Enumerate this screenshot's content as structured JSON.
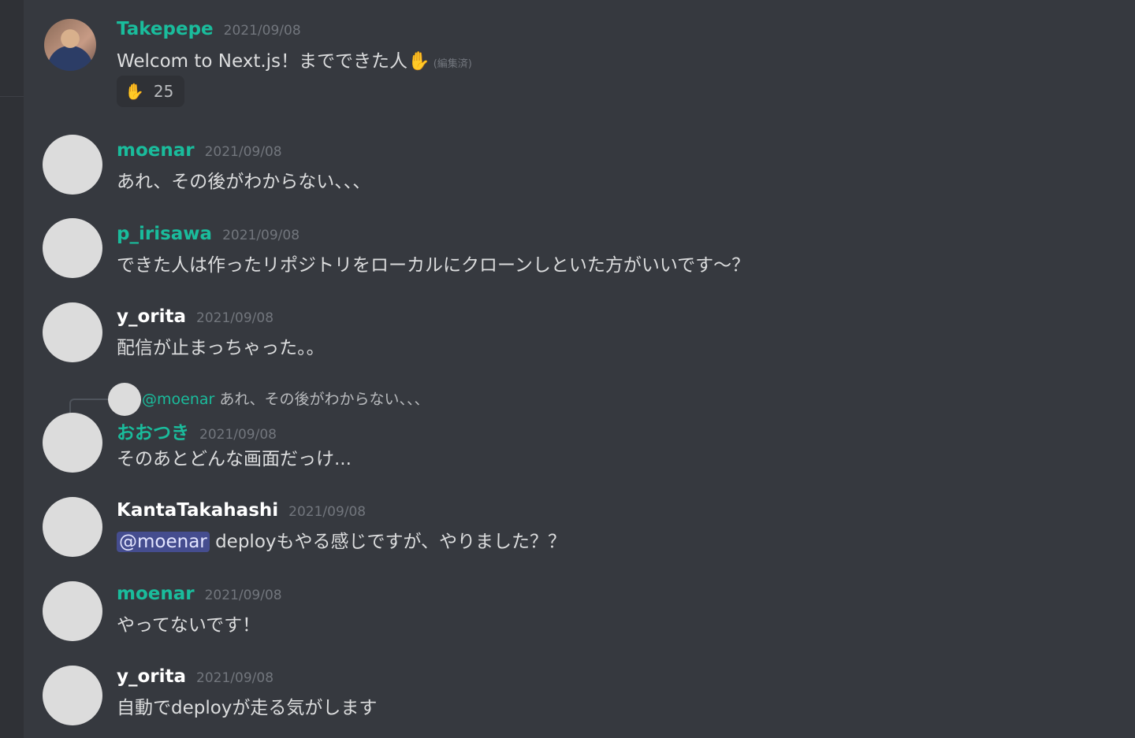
{
  "messages": [
    {
      "username": "Takepepe",
      "timestamp": "2021/09/08",
      "content": "Welcom to Next.js！までできた人",
      "hand": "✋",
      "edited": "(編集済)",
      "reaction": {
        "emoji": "✋",
        "count": "25"
      }
    },
    {
      "username": "moenar",
      "timestamp": "2021/09/08",
      "content": "あれ、その後がわからない、、、"
    },
    {
      "username": "p_irisawa",
      "timestamp": "2021/09/08",
      "content": "できた人は作ったリポジトリをローカルにクローンしといた方がいいです〜？"
    },
    {
      "username": "y_orita",
      "timestamp": "2021/09/08",
      "content": "配信が止まっちゃった。。"
    },
    {
      "reply": {
        "mention": "@moenar",
        "text": "あれ、その後がわからない、、、"
      },
      "username": "おおつき",
      "timestamp": "2021/09/08",
      "content": "そのあとどんな画面だっけ..."
    },
    {
      "username": "KantaTakahashi",
      "timestamp": "2021/09/08",
      "mention": "@moenar",
      "content": " deployもやる感じですが、やりました？？"
    },
    {
      "username": "moenar",
      "timestamp": "2021/09/08",
      "content": "やってないです！"
    },
    {
      "username": "y_orita",
      "timestamp": "2021/09/08",
      "content": "自動でdeployが走る気がします"
    }
  ],
  "colors": {
    "background": "#36393f",
    "username_green": "#1abc9c",
    "username_white": "#ffffff",
    "mention_bg": "#5865f2"
  }
}
